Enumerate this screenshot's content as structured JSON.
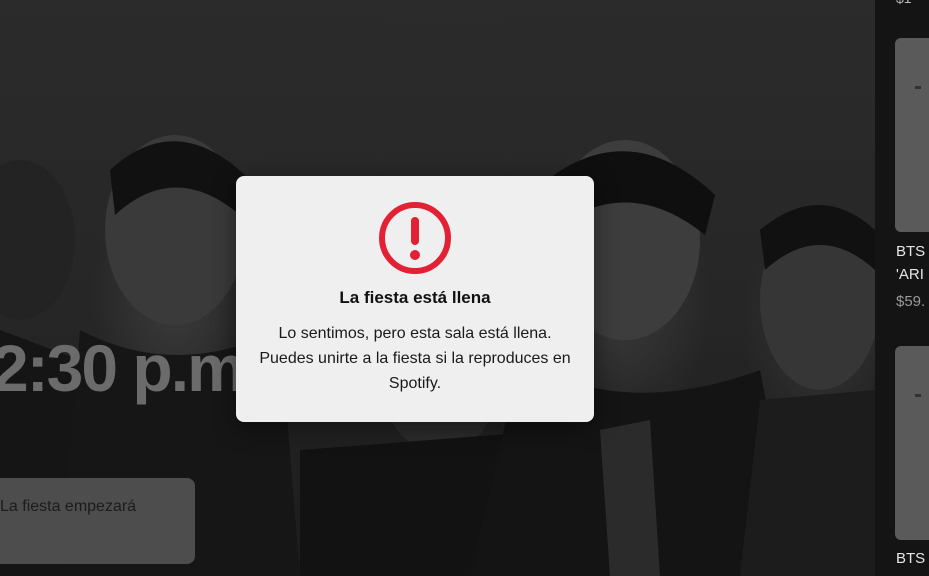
{
  "hero": {
    "time_text": "2:30 p.m. (",
    "party_card_text": "La fiesta empezará"
  },
  "modal": {
    "icon": "exclamation-circle-icon",
    "icon_color": "#e22134",
    "title": "La fiesta está llena",
    "body": "Lo sentimos, pero esta sala está llena. Puedes unirte a la fiesta si la reproduces en Spotify."
  },
  "sidebar": {
    "top_stub": "$1",
    "products": [
      {
        "title_line1": "BTS",
        "title_line2": "'ARI",
        "price": "$59."
      },
      {
        "title_line1": "BTS"
      }
    ]
  }
}
